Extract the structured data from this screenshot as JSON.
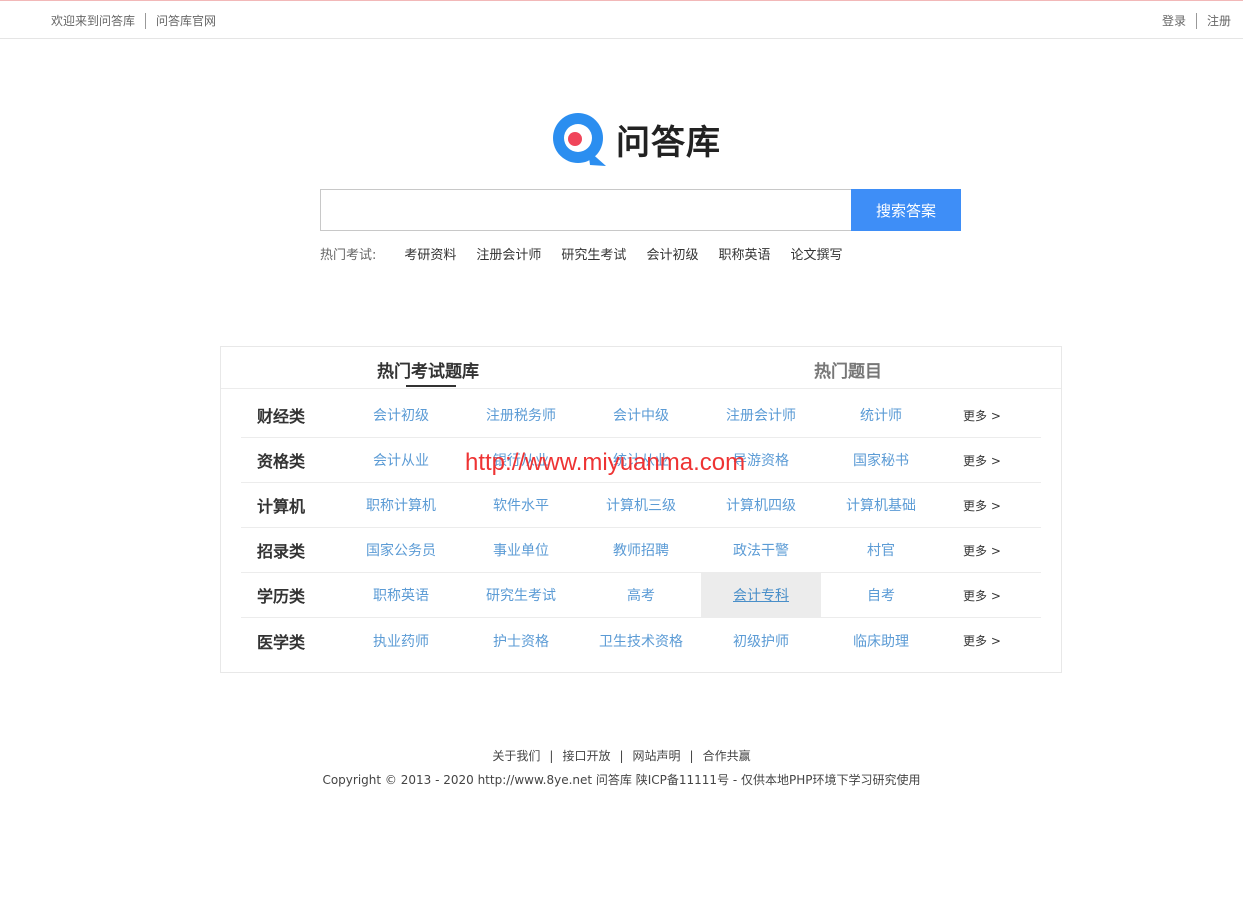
{
  "topbar": {
    "welcome": "欢迎来到问答库",
    "official": "问答库官网",
    "login": "登录",
    "register": "注册"
  },
  "logo": {
    "text": "问答库",
    "icon": "q-logo-icon",
    "accent": "#2b8ef0"
  },
  "search": {
    "placeholder": "",
    "value": "",
    "button": "搜索答案",
    "button_color": "#3e8ef7"
  },
  "hot": {
    "label": "热门考试:",
    "items": [
      "考研资料",
      "注册会计师",
      "研究生考试",
      "会计初级",
      "职称英语",
      "论文撰写"
    ]
  },
  "tabs": {
    "active": "热门考试题库",
    "inactive": "热门题目"
  },
  "categories": [
    {
      "name": "财经类",
      "items": [
        "会计初级",
        "注册税务师",
        "会计中级",
        "注册会计师",
        "统计师"
      ],
      "more": "更多 >"
    },
    {
      "name": "资格类",
      "items": [
        "会计从业",
        "银行从业",
        "统计从业",
        "导游资格",
        "国家秘书"
      ],
      "more": "更多 >"
    },
    {
      "name": "计算机",
      "items": [
        "职称计算机",
        "软件水平",
        "计算机三级",
        "计算机四级",
        "计算机基础"
      ],
      "more": "更多 >"
    },
    {
      "name": "招录类",
      "items": [
        "国家公务员",
        "事业单位",
        "教师招聘",
        "政法干警",
        "村官"
      ],
      "more": "更多 >"
    },
    {
      "name": "学历类",
      "items": [
        "职称英语",
        "研究生考试",
        "高考",
        "会计专科",
        "自考"
      ],
      "more": "更多 >"
    },
    {
      "name": "医学类",
      "items": [
        "执业药师",
        "护士资格",
        "卫生技术资格",
        "初级护师",
        "临床助理"
      ],
      "more": "更多 >"
    }
  ],
  "watermark": "http://www.miyuanma.com",
  "footer": {
    "links": [
      "关于我们",
      "接口开放",
      "网站声明",
      "合作共赢"
    ],
    "copyright": "Copyright © 2013 - 2020 http://www.8ye.net  问答库   陕ICP备11111号 - 仅供本地PHP环境下学习研究使用"
  }
}
